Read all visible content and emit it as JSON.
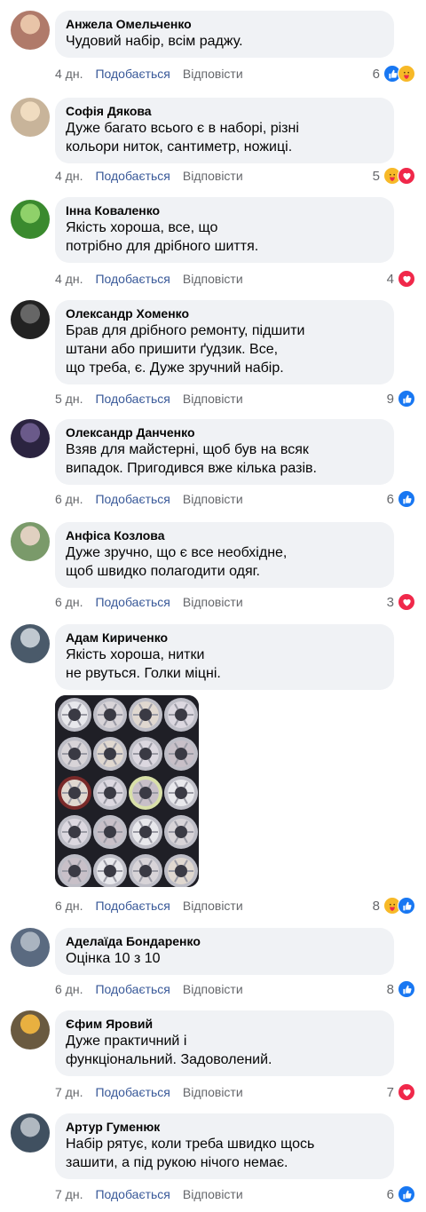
{
  "comments": [
    {
      "name": "Анжела Омельченко",
      "text": "Чудовий набір, всім раджу.",
      "time": "4 дн.",
      "like": "Подобається",
      "reply": "Відповісти",
      "count": "6",
      "reactions": [
        "like",
        "care"
      ]
    },
    {
      "name": "Софія Дякова",
      "text": "Дуже багато всього є в наборі, різні\nкольори ниток, сантиметр, ножиці.",
      "time": "4 дн.",
      "like": "Подобається",
      "reply": "Відповісти",
      "count": "5",
      "reactions": [
        "care",
        "love"
      ]
    },
    {
      "name": "Інна Коваленко",
      "text": "Якість хороша, все, що\nпотрібно для дрібного шиття.",
      "time": "4 дн.",
      "like": "Подобається",
      "reply": "Відповісти",
      "count": "4",
      "reactions": [
        "love"
      ]
    },
    {
      "name": "Олександр Хоменко",
      "text": "Брав для дрібного ремонту, підшити\nштани або пришити ґудзик. Все,\nщо треба, є. Дуже зручний набір.",
      "time": "5 дн.",
      "like": "Подобається",
      "reply": "Відповісти",
      "count": "9",
      "reactions": [
        "like"
      ]
    },
    {
      "name": "Олександр Данченко",
      "text": "Взяв для майстерні, щоб був на всяк\nвипадок. Пригодився вже кілька разів.",
      "time": "6 дн.",
      "like": "Подобається",
      "reply": "Відповісти",
      "count": "6",
      "reactions": [
        "like"
      ]
    },
    {
      "name": "Анфіса Козлова",
      "text": "Дуже зручно, що є все необхідне,\nщоб швидко полагодити одяг.",
      "time": "6 дн.",
      "like": "Подобається",
      "reply": "Відповісти",
      "count": "3",
      "reactions": [
        "love"
      ]
    },
    {
      "name": "Адам Кириченко",
      "text": "Якість хороша, нитки\nне рвуться. Голки міцні.",
      "time": "6 дн.",
      "like": "Подобається",
      "reply": "Відповісти",
      "count": "8",
      "reactions": [
        "care",
        "like"
      ]
    },
    {
      "name": "Аделаїда Бондаренко",
      "text": "Оцінка 10 з 10",
      "time": "6 дн.",
      "like": "Подобається",
      "reply": "Відповісти",
      "count": "8",
      "reactions": [
        "like"
      ]
    },
    {
      "name": "Єфим Яровий",
      "text": "Дуже практичний і\nфункціональний. Задоволений.",
      "time": "7 дн.",
      "like": "Подобається",
      "reply": "Відповісти",
      "count": "7",
      "reactions": [
        "love"
      ]
    },
    {
      "name": "Артур Гуменюк",
      "text": "Набір рятує, коли треба швидко щось\nзашити, а під рукою нічого немає.",
      "time": "7 дн.",
      "like": "Подобається",
      "reply": "Відповісти",
      "count": "6",
      "reactions": [
        "like"
      ]
    }
  ],
  "colors": {
    "bubble": "#f0f2f5",
    "link": "#385898",
    "meta": "#65676b",
    "like_reaction": "#1877f2",
    "love_reaction": "#f0284a",
    "care_reaction": "#f7b928"
  },
  "icons": {
    "like": "thumbs-up-icon",
    "love": "heart-icon",
    "care": "care-hug-icon"
  }
}
